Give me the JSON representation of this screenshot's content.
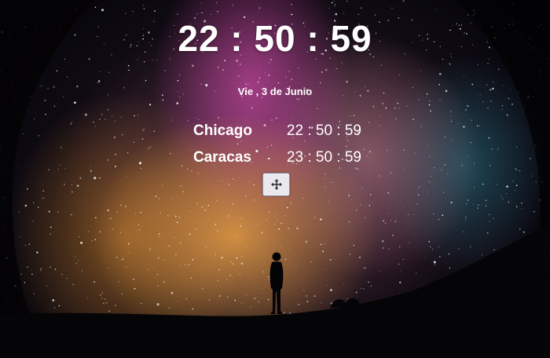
{
  "clock": {
    "time": "22 : 50 : 59"
  },
  "date": {
    "text": "Vie , 3 de Junio"
  },
  "zones": [
    {
      "city": "Chicago",
      "time": "22 : 50 : 59"
    },
    {
      "city": "Caracas",
      "time": "23 : 50 : 59"
    }
  ],
  "controls": {
    "move_icon": "move-arrows-icon"
  },
  "colors": {
    "text": "#ffffff",
    "button_bg": "#e9e9ee",
    "button_border": "#8b8ba0"
  }
}
